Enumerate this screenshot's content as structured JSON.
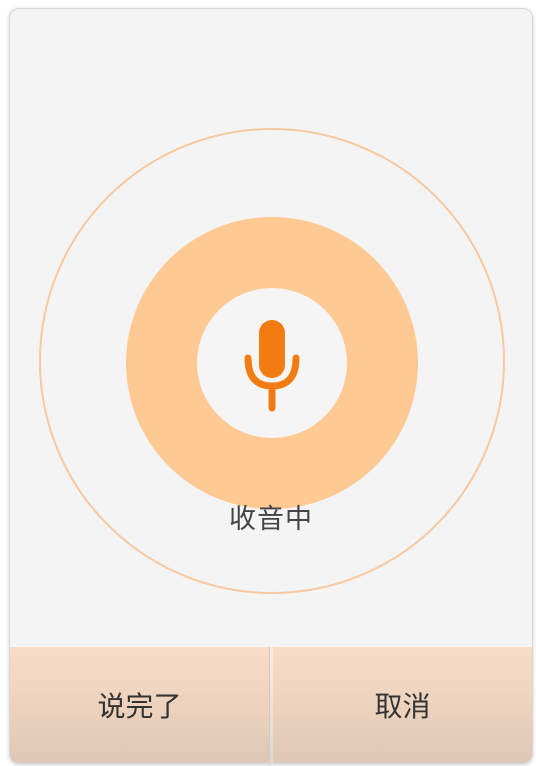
{
  "dialog": {
    "status_text": "收音中",
    "finish_button_label": "说完了",
    "cancel_button_label": "取消"
  },
  "icons": {
    "mic": "microphone-icon"
  },
  "colors": {
    "dialog_background": "#f4f4f4",
    "pulse_circle": "#fec993",
    "outer_ring": "#f7c9a0",
    "mic_icon": "#f07c12",
    "button_bar": "#ecd2bd",
    "text": "#444444"
  }
}
